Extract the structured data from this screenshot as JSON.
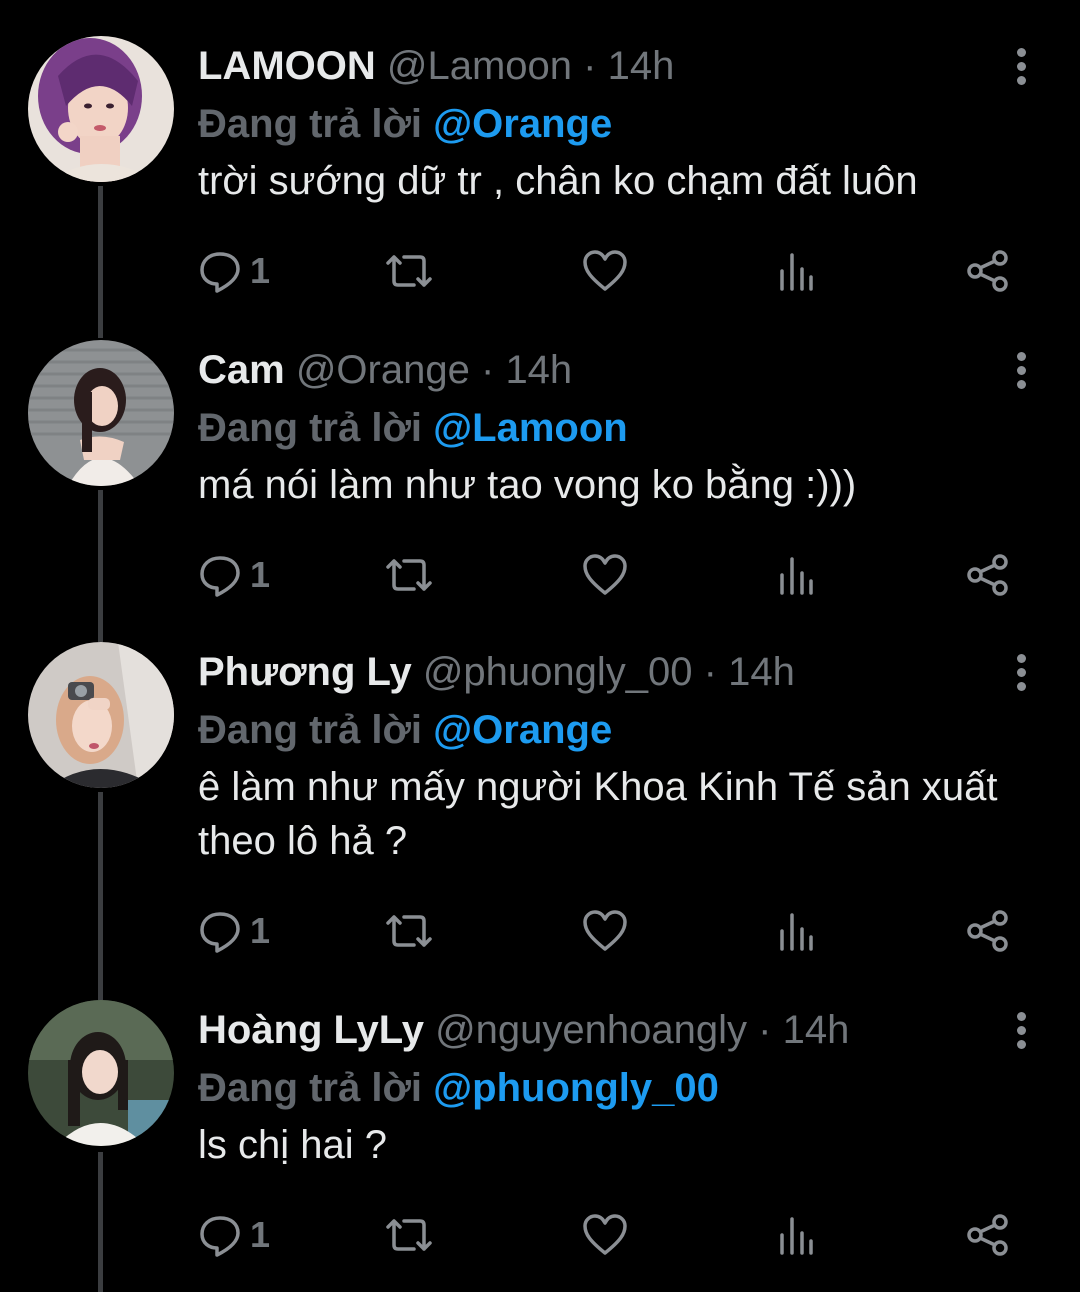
{
  "reply_prefix": "Đang trả lời",
  "tweets": [
    {
      "name": "LAMOON",
      "handle": "@Lamoon",
      "separator": "·",
      "time": "14h",
      "reply_to": "@Orange",
      "text": "trời sướng dữ tr , chân ko chạm đất luôn",
      "reply_count": "1"
    },
    {
      "name": "Cam",
      "handle": "@Orange",
      "separator": "·",
      "time": "14h",
      "reply_to": "@Lamoon",
      "text": "má nói làm như tao vong ko bằng :)))",
      "reply_count": "1"
    },
    {
      "name": "Phương Ly",
      "handle": "@phuongly_00",
      "separator": "·",
      "time": "14h",
      "reply_to": "@Orange",
      "text": "ê làm như mấy người Khoa Kinh Tế sản xuất theo lô hả ?",
      "reply_count": "1"
    },
    {
      "name": "Hoàng LyLy",
      "handle": "@nguyenhoangly",
      "separator": "·",
      "time": "14h",
      "reply_to": "@phuongly_00",
      "text": "ls chị hai ?",
      "reply_count": "1"
    }
  ],
  "icons": {
    "reply": "reply-icon",
    "retweet": "retweet-icon",
    "like": "heart-icon",
    "views": "analytics-icon",
    "share": "share-icon",
    "more": "more-options-icon"
  },
  "colors": {
    "background": "#000000",
    "text": "#e7e9ea",
    "muted": "#71767b",
    "mention": "#1d9bf0",
    "thread_line": "#3b3d40"
  }
}
